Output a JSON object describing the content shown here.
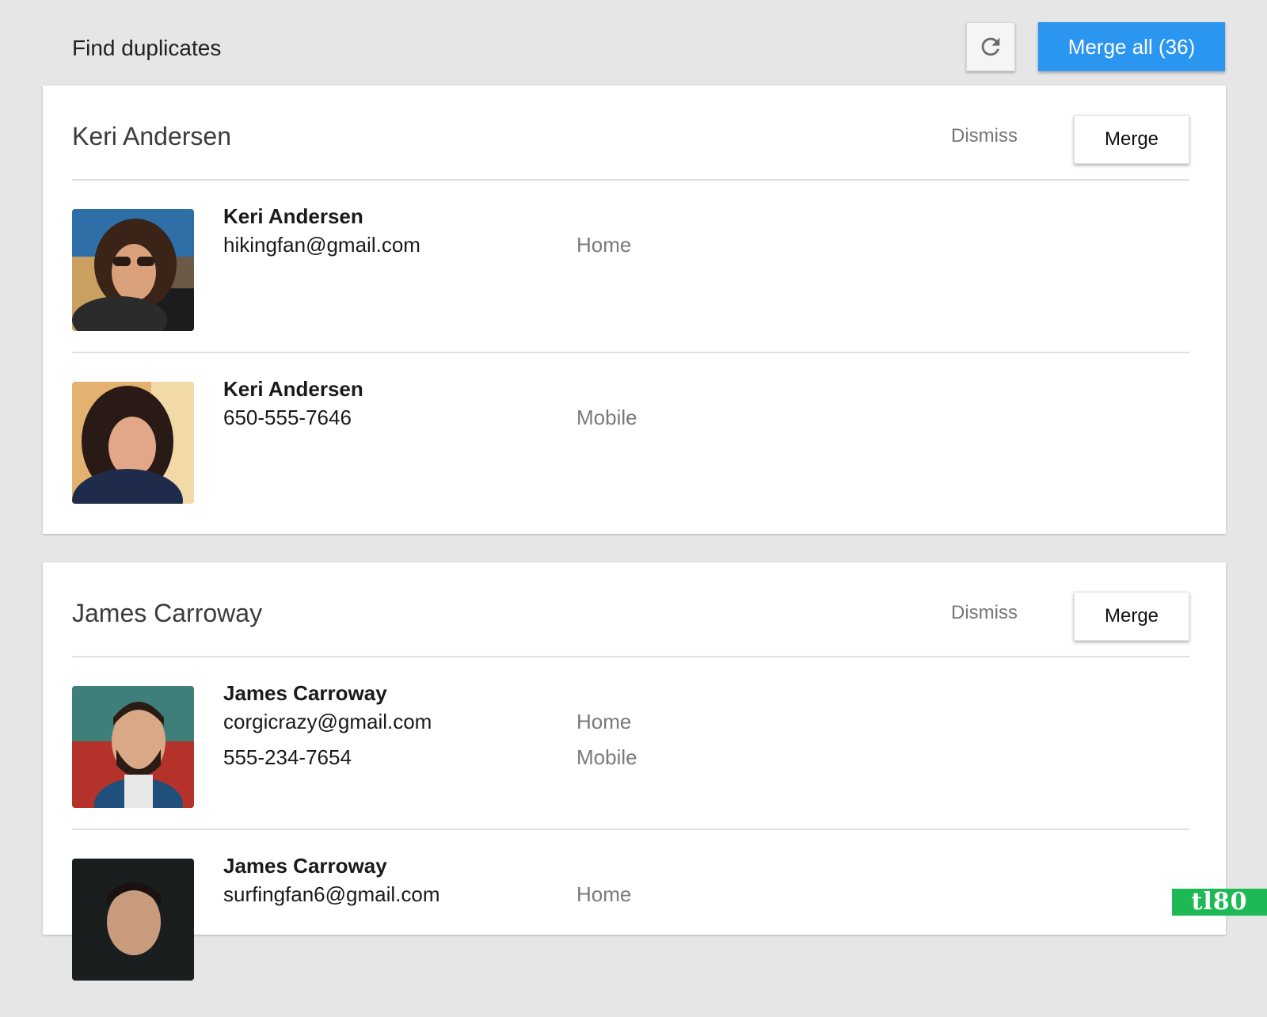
{
  "header": {
    "title": "Find duplicates",
    "refresh_icon": "refresh-icon",
    "merge_all_label": "Merge all (36)",
    "accent_color": "#2b96f0"
  },
  "groups": [
    {
      "title": "Keri Andersen",
      "dismiss_label": "Dismiss",
      "merge_label": "Merge",
      "contacts": [
        {
          "name": "Keri Andersen",
          "lines": [
            {
              "value": "hikingfan@gmail.com",
              "type": "Home"
            }
          ]
        },
        {
          "name": "Keri Andersen",
          "lines": [
            {
              "value": "650-555-7646",
              "type": "Mobile"
            }
          ]
        }
      ]
    },
    {
      "title": "James Carroway",
      "dismiss_label": "Dismiss",
      "merge_label": "Merge",
      "contacts": [
        {
          "name": "James Carroway",
          "lines": [
            {
              "value": "corgicrazy@gmail.com",
              "type": "Home"
            },
            {
              "value": "555-234-7654",
              "type": "Mobile"
            }
          ]
        },
        {
          "name": "James Carroway",
          "lines": [
            {
              "value": "surfingfan6@gmail.com",
              "type": "Home"
            }
          ]
        }
      ]
    }
  ],
  "watermark": "tl80"
}
